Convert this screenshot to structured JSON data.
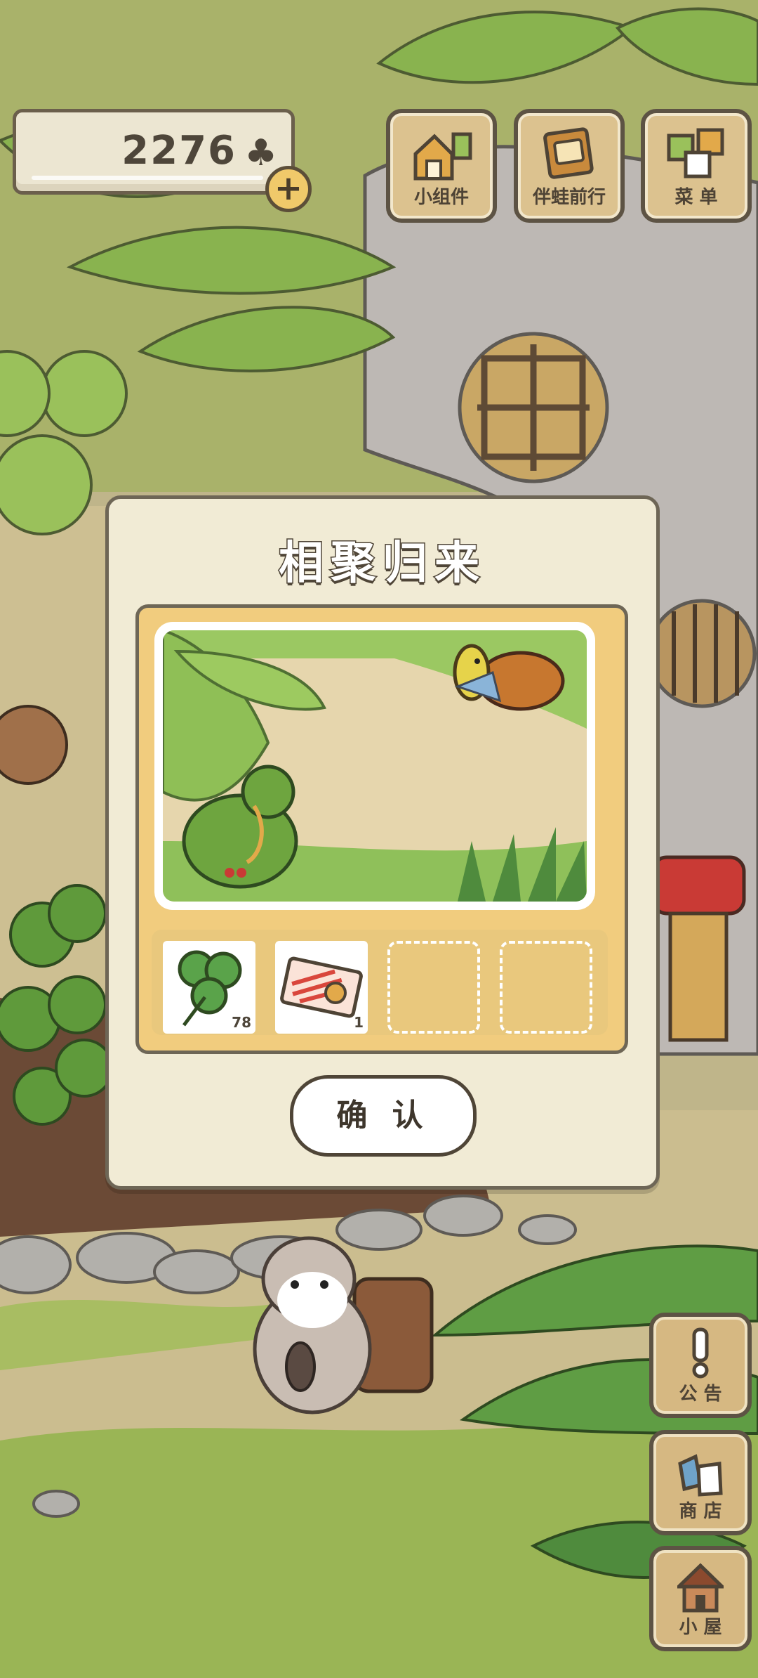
{
  "currency": {
    "amount": "2276",
    "icon": "clover-icon",
    "add_icon": "plus-icon"
  },
  "top_menu": [
    {
      "label": "小组件",
      "icon": "widget-icon"
    },
    {
      "label": "伴蛙前行",
      "icon": "journal-icon"
    },
    {
      "label": "菜 单",
      "icon": "menu-cards-icon"
    }
  ],
  "side_menu": [
    {
      "label": "公 告",
      "icon": "exclamation-icon"
    },
    {
      "label": "商 店",
      "icon": "shop-bags-icon"
    },
    {
      "label": "小 屋",
      "icon": "house-icon"
    }
  ],
  "dialog": {
    "title": "相聚归来",
    "photo": "frog-with-turtle-photo",
    "items": [
      {
        "name": "clover",
        "icon": "clover-icon",
        "qty": "78"
      },
      {
        "name": "ticket",
        "icon": "ticket-icon",
        "qty": "1"
      },
      {
        "name": "empty"
      },
      {
        "name": "empty"
      }
    ],
    "confirm_label": "确 认"
  },
  "colors": {
    "dialog_bg": "#f1ebd5",
    "frame_gold": "#f1cc7e",
    "button_wood": "#d6b882",
    "outline": "#5d5344"
  }
}
